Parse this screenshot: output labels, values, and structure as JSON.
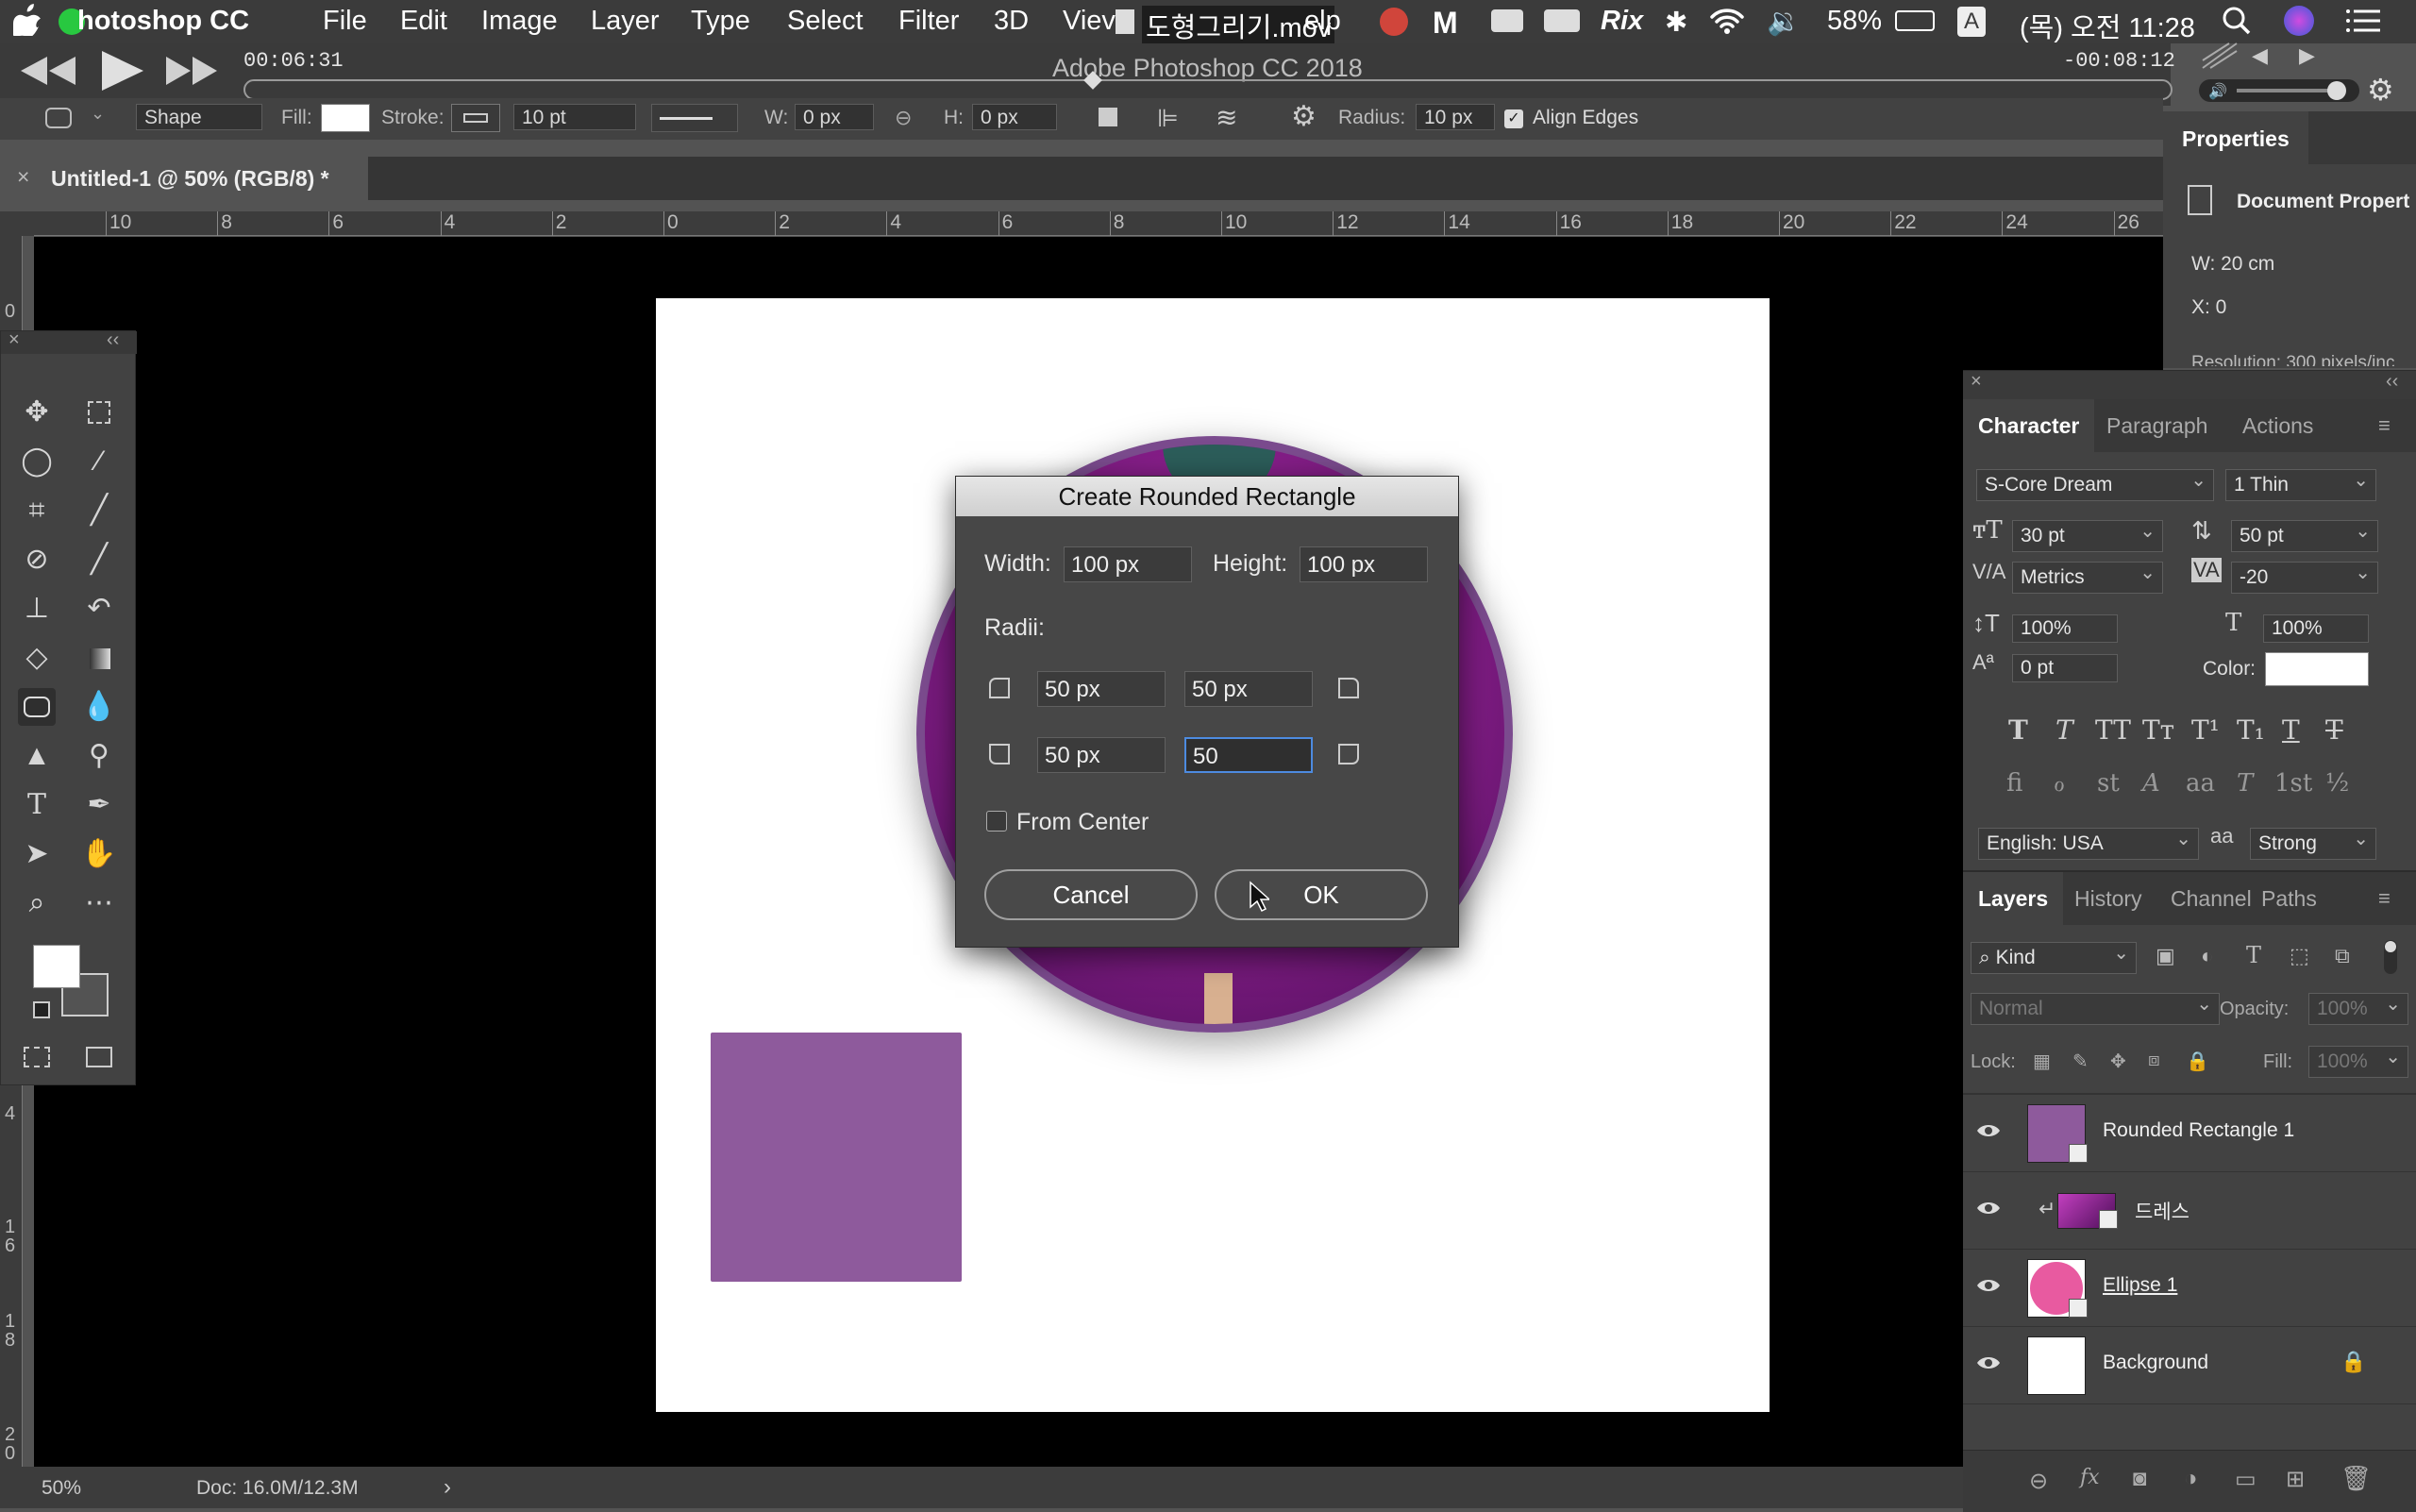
{
  "menubar": {
    "app": "hotoshop CC",
    "items": [
      "File",
      "Edit",
      "Image",
      "Layer",
      "Type",
      "Select",
      "Filter",
      "3D",
      "Viev",
      "elp"
    ],
    "overlay_title": "도형그리기.mov",
    "battery": "58%",
    "input_source": "A",
    "clock": "(목) 오전 11:28",
    "status_icons": [
      "record-icon",
      "malwarebytes-icon",
      "cloud-icon",
      "cloud-alt-icon",
      "rix-icon",
      "bluetooth-icon",
      "wifi-icon",
      "volume-icon",
      "battery-icon",
      "search-icon",
      "siri-icon",
      "list-icon"
    ],
    "rix": "Rix"
  },
  "player": {
    "elapsed": "00:06:31",
    "title": "Adobe Photoshop CC 2018",
    "remaining": "-00:08:12",
    "progress": 0.44
  },
  "options": {
    "mode": "Shape",
    "fill_label": "Fill:",
    "stroke_label": "Stroke:",
    "stroke_width": "10 pt",
    "w_label": "W:",
    "w_value": "0 px",
    "h_label": "H:",
    "h_value": "0 px",
    "radius_label": "Radius:",
    "radius_value": "10 px",
    "align_edges": "Align Edges"
  },
  "doc_tab": {
    "close": "×",
    "title": "Untitled-1 @ 50% (RGB/8) *"
  },
  "ruler": {
    "h_labels": [
      "10",
      "8",
      "6",
      "4",
      "2",
      "0",
      "2",
      "4",
      "6",
      "8",
      "10",
      "12",
      "14",
      "16",
      "18",
      "20",
      "22",
      "24",
      "26"
    ],
    "v_labels": [
      "0",
      "4",
      "1 6",
      "1 8",
      "2 0"
    ]
  },
  "status": {
    "zoom": "50%",
    "doc": "Doc: 16.0M/12.3M",
    "arrow": "›"
  },
  "dialog": {
    "title": "Create Rounded Rectangle",
    "width_label": "Width:",
    "width_value": "100 px",
    "height_label": "Height:",
    "height_value": "100 px",
    "radii_label": "Radii:",
    "radius_tl": "50 px",
    "radius_tr": "50 px",
    "radius_bl": "50 px",
    "radius_br": "50",
    "from_center": "From Center",
    "cancel": "Cancel",
    "ok": "OK"
  },
  "properties": {
    "title": "Properties",
    "doc_props": "Document Propert",
    "w": "W: 20 cm",
    "x": "X: 0",
    "resolution": "Resolution: 300 pixels/inc"
  },
  "character": {
    "tabs": [
      "Character",
      "Paragraph",
      "Actions"
    ],
    "font": "S-Core Dream",
    "style": "1 Thin",
    "size": "30 pt",
    "leading": "50 pt",
    "kerning": "Metrics",
    "tracking": "-20",
    "vscale": "100%",
    "hscale": "100%",
    "baseline": "0 pt",
    "color_label": "Color:",
    "color": "#ffffff",
    "language": "English: USA",
    "aa_icon": "aa",
    "antialias": "Strong",
    "glyphs_row1": [
      "T",
      "T",
      "TT",
      "Tт",
      "T¹",
      "T₁",
      "T",
      "T"
    ],
    "glyphs_row2": [
      "fi",
      "ℴ",
      "st",
      "A",
      "aa",
      "T",
      "1st",
      "½"
    ]
  },
  "layers": {
    "tabs": [
      "Layers",
      "History",
      "Channel",
      "Paths"
    ],
    "filter": "Kind",
    "blend": "Normal",
    "opacity_label": "Opacity:",
    "opacity": "100%",
    "lock_label": "Lock:",
    "fill_label": "Fill:",
    "fill": "100%",
    "items": [
      {
        "name": "Rounded Rectangle 1",
        "thumb": "#8e5a9c",
        "shape": true
      },
      {
        "name": "드레스",
        "thumb": "#7a1a7a",
        "clipped": true
      },
      {
        "name": "Ellipse 1",
        "thumb": "#e85aa0",
        "shape": true
      },
      {
        "name": "Background",
        "thumb": "#ffffff",
        "locked": true
      }
    ]
  },
  "colors": {
    "accent": "#4d8be0",
    "purple_rect": "#8e5a9c",
    "circle_ring": "#7b4b8e"
  }
}
